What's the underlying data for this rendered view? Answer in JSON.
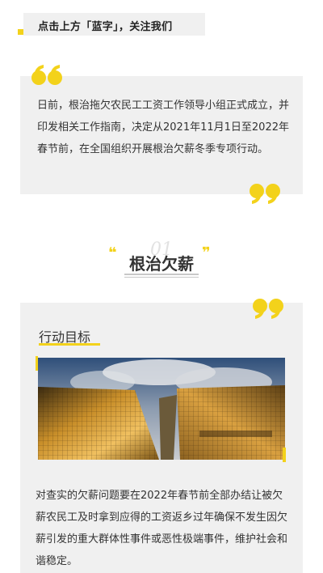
{
  "follow_banner": {
    "text": "点击上方「蓝字」，关注我们"
  },
  "intro": {
    "text": "日前，根治拖欠农民工工资工作领导小组正式成立，并印发相关工作指南，决定从2021年11月1日至2022年春节前，在全国组织开展根治欠薪冬季专项行动。"
  },
  "section": {
    "number": "01",
    "title": "根治欠薪",
    "quote_mark_left": "❝",
    "quote_mark_right": "❞"
  },
  "goal": {
    "title": "行动目标",
    "text": "对查实的欠薪问题要在2022年春节前全部办结让被欠薪农民工及时拿到应得的工资返乡过年确保不发生因欠薪引发的重大群体性事件或恶性极端事件，维护社会和谐稳定。"
  },
  "colors": {
    "accent": "#f3d21b",
    "panel": "#f0f0f0",
    "text": "#333333"
  },
  "icons": [
    "quote-open-icon",
    "quote-close-icon"
  ]
}
